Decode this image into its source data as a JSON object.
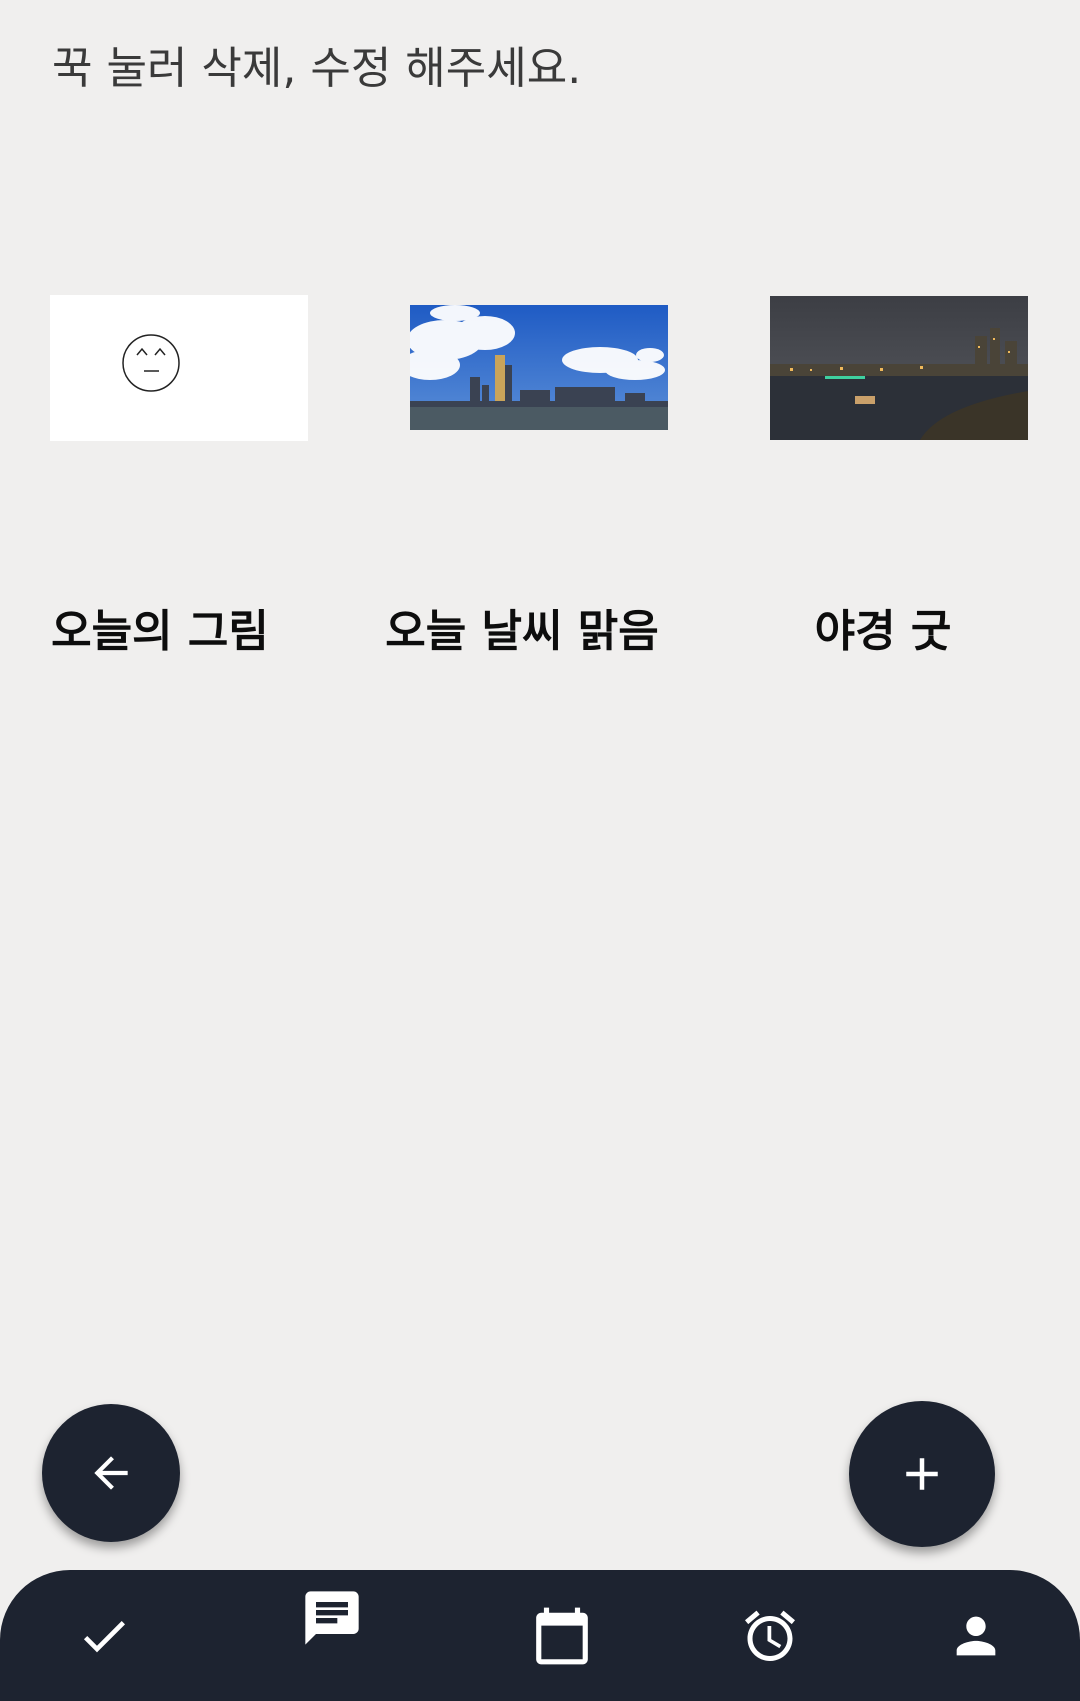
{
  "hint_text": "꾹 눌러 삭제, 수정 해주세요.",
  "cards": [
    {
      "caption": "오늘의 그림",
      "image": "drawing-smiley"
    },
    {
      "caption": "오늘 날씨 맑음",
      "image": "city-skyline-daytime"
    },
    {
      "caption": "야경 굿",
      "image": "city-river-night"
    }
  ],
  "fabs": {
    "back": "arrow-left-icon",
    "add": "plus-icon"
  },
  "bottom_nav": [
    "check-icon",
    "chat-icon",
    "calendar-icon",
    "alarm-icon",
    "person-icon"
  ],
  "colors": {
    "background": "#f0efee",
    "dark": "#1d2330",
    "icon": "#ffffff"
  }
}
